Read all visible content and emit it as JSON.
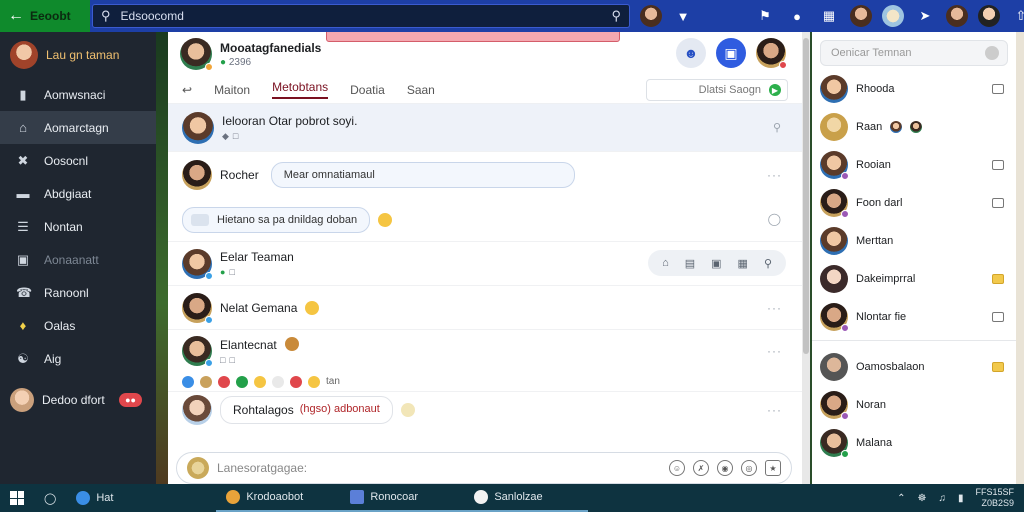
{
  "topbar": {
    "brand": "Eeoobt",
    "search_value": "Edsoocomd"
  },
  "sidebar": {
    "user_label": "Lau gn taman",
    "items": [
      {
        "label": "Aomwsnaci",
        "icon": "folder-icon"
      },
      {
        "label": "Aomarctagn",
        "icon": "home-icon",
        "active": true
      },
      {
        "label": "Oosocnl",
        "icon": "tools-icon"
      },
      {
        "label": "Abdgiaat",
        "icon": "window-icon"
      },
      {
        "label": "Nontan",
        "icon": "list-icon"
      },
      {
        "label": "Aonaanatt",
        "icon": "message-icon",
        "muted": true
      },
      {
        "label": "Ranoonl",
        "icon": "comment-icon"
      },
      {
        "label": "Oalas",
        "icon": "bell-icon"
      },
      {
        "label": "Aig",
        "icon": "gift-icon"
      }
    ],
    "bottom_user": "Dedoo dfort"
  },
  "chat": {
    "header": {
      "title": "Mooatagfanedials",
      "subtitle": "2396"
    },
    "tabs": [
      "Maiton",
      "Metobtans",
      "Doatia",
      "Saan"
    ],
    "active_tab": 1,
    "search_label": "Dlatsi Saogn",
    "messages": [
      {
        "name": "Ielooran Otar pobrot soyi.",
        "type": "pinned"
      },
      {
        "name": "Rocher",
        "bubble": "Mear omnatiamaul"
      },
      {
        "bubble": "Hietano sa pa dnildag doban",
        "type": "bubble-only"
      },
      {
        "name": "Eelar Teaman",
        "type": "tools"
      },
      {
        "name": "Nelat Gemana"
      },
      {
        "name": "Elantecnat"
      },
      {
        "name": "Rohtalagos",
        "inline": "(hgso) adbonaut"
      }
    ],
    "react_text": "tan",
    "composer_placeholder": "Lanesoratgagae:"
  },
  "contacts": {
    "search_placeholder": "Oenicar Temnan",
    "list": [
      {
        "name": "Rhooda"
      },
      {
        "name": "Raan"
      },
      {
        "name": "Rooian"
      },
      {
        "name": "Foon darl"
      },
      {
        "name": "Merttan"
      },
      {
        "name": "Dakeimprral"
      },
      {
        "name": "Nlontar fie"
      }
    ],
    "list2": [
      {
        "name": "Oamosbalaon"
      },
      {
        "name": "Noran"
      },
      {
        "name": "Malana"
      }
    ]
  },
  "taskbar": {
    "search": "Hat",
    "apps": [
      "Krodoaobot",
      "Ronocoar",
      "Sanlolzae"
    ],
    "clock_time": "FFS15SF",
    "clock_date": "Z0B2S9"
  },
  "colors": {
    "topbar": "#1d3fa6",
    "accent": "#2f5ce0",
    "active_tab": "#7a1020",
    "sidebar": "#1f2630"
  }
}
